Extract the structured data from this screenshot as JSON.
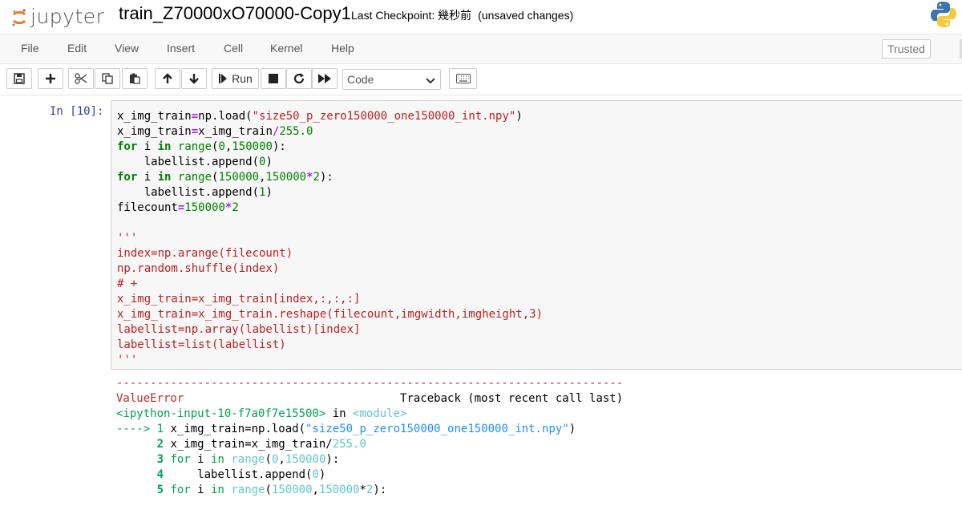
{
  "header": {
    "logo_text": "jupyter",
    "notebook_name": "train_Z70000xO70000-Copy1",
    "checkpoint_label": "Last Checkpoint: 幾秒前",
    "autosave_status": "(unsaved changes)"
  },
  "menu": {
    "items": [
      "File",
      "Edit",
      "View",
      "Insert",
      "Cell",
      "Kernel",
      "Help"
    ],
    "trusted_label": "Trusted"
  },
  "toolbar": {
    "run_label": "Run",
    "cell_type": "Code",
    "icons": [
      "save-icon",
      "plus-icon",
      "cut-icon",
      "copy-icon",
      "paste-icon",
      "arrow-up-icon",
      "arrow-down-icon",
      "step-forward-icon",
      "stop-icon",
      "restart-icon",
      "fast-forward-icon",
      "keyboard-icon"
    ]
  },
  "cell": {
    "prompt": "In [10]:",
    "source_lines": [
      "x_img_train=np.load(\"size50_p_zero150000_one150000_int.npy\")",
      "x_img_train=x_img_train/255.0",
      "for i in range(0,150000):",
      "    labellist.append(0)",
      "for i in range(150000,150000*2):",
      "    labellist.append(1)",
      "filecount=150000*2",
      "",
      "'''",
      "index=np.arange(filecount)",
      "np.random.shuffle(index)",
      "# +",
      "x_img_train=x_img_train[index,:,:,:]",
      "x_img_train=x_img_train.reshape(filecount,imgwidth,imgheight,3)",
      "labellist=np.array(labellist)[index]",
      "labellist=list(labellist)",
      "'''"
    ]
  },
  "output": {
    "separator": "---------------------------------------------------------------------------",
    "error_name": "ValueError",
    "traceback_header": "Traceback (most recent call last)",
    "input_ref": "<ipython-input-10-f7a0f7e15500>",
    "in_word": "in",
    "module_ref": "<module>",
    "arrow": "---->",
    "trace_lines": [
      {
        "num": "1",
        "code": "x_img_train=np.load(\"size50_p_zero150000_one150000_int.npy\")"
      },
      {
        "num": "2",
        "code": "x_img_train=x_img_train/255.0"
      },
      {
        "num": "3",
        "code": "for i in range(0,150000):"
      },
      {
        "num": "4",
        "code": "    labellist.append(0)"
      },
      {
        "num": "5",
        "code": "for i in range(150000,150000*2):"
      }
    ]
  }
}
